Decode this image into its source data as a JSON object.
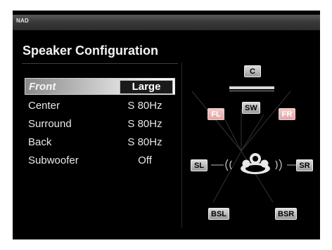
{
  "brand": "NAD",
  "page_title": "Speaker Configuration",
  "settings": [
    {
      "label": "Front",
      "value": "Large"
    },
    {
      "label": "Center",
      "value": "S 80Hz"
    },
    {
      "label": "Surround",
      "value": "S 80Hz"
    },
    {
      "label": "Back",
      "value": "S 80Hz"
    },
    {
      "label": "Subwoofer",
      "value": "Off"
    }
  ],
  "speakers": {
    "c": "C",
    "sw": "SW",
    "fl": "FL",
    "fr": "FR",
    "sl": "SL",
    "sr": "SR",
    "bsl": "BSL",
    "bsr": "BSR"
  },
  "colors": {
    "screen_bg": "#000000",
    "highlight_speaker": "#e6a8a8"
  }
}
